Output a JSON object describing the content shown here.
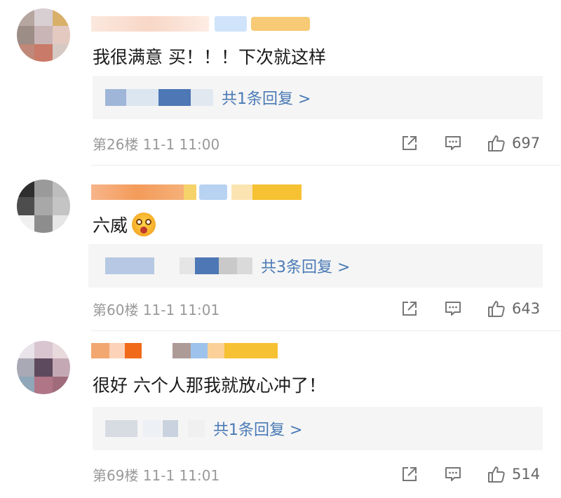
{
  "comments": [
    {
      "username": "",
      "badge": "",
      "text": "我很满意 买！！！下次就这样",
      "reply_count_label": "共1条回复 >",
      "floor_time": "第26楼 11-1 11:00",
      "like_count": "697"
    },
    {
      "username": "",
      "badge": "",
      "text": "六威",
      "reply_count_label": "共3条回复 >",
      "floor_time": "第60楼 11-1 11:01",
      "like_count": "643"
    },
    {
      "username": "",
      "badge": "",
      "text": "很好 六个人那我就放心冲了！",
      "reply_count_label": "共1条回复 >",
      "floor_time": "第69楼 11-1 11:01",
      "like_count": "514"
    }
  ],
  "icons": {
    "share": "share-icon",
    "comment": "comment-icon",
    "like": "thumbs-up-icon"
  },
  "colors": {
    "reply_link": "#4a7ab5",
    "meta_text": "#999999",
    "reply_bg": "#f5f5f5"
  }
}
